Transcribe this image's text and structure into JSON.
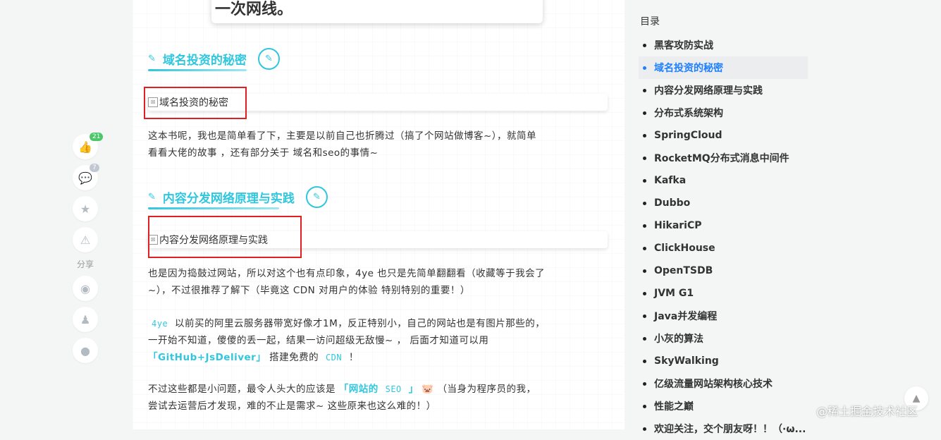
{
  "quote": {
    "text": "一次网线。"
  },
  "sections": [
    {
      "heading": "域名投资的秘密",
      "image_alt": "域名投资的秘密",
      "paragraph_1": "这本书呢，我也是简单看了下，主要是以前自己也折腾过（搞了个网站做博客~），就简单",
      "paragraph_2": "看看大佬的故事 ，还有部分关于 域名和seo的事情~"
    },
    {
      "heading": "内容分发网络原理与实践",
      "image_alt": "内容分发网络原理与实践",
      "p1_line1": "也是因为捣鼓过网站，所以对这个也有点印象，4ye 也只是先简单翻翻看（收藏等于我会了",
      "p1_line2": "~），不过很推荐了解下（毕竟这 CDN 对用户的体验 特别特别的重要！）",
      "p2_code_1": "4ye",
      "p2_line1": "以前买的阿里云服务器带宽好像才1M，反正特别小，自己的网站也是有图片那些的，",
      "p2_line2": "一开始不知道，傻傻的丢一起，结果一访问超级无敌慢~ ，  后面才知道可以用",
      "p2_hl_1": "「GitHub+JsDeliver」",
      "p2_mid": "搭建免费的",
      "p2_code_2": "CDN",
      "p2_end": "！",
      "p3_start": "不过这些都是小问题，最令人头大的应该是",
      "p3_hl_1": "「网站的",
      "p3_code": "SEO",
      "p3_hl_2": "」",
      "p3_emoji": "🐷",
      "p3_end": "（当身为程序员的我，",
      "p3_line2": "尝试去运营后才发现，难的不止是需求~ 这些原来也这么难的！）"
    }
  ],
  "actions": {
    "like_count": "21",
    "comment_count": "7",
    "share_label": "分享"
  },
  "toc": {
    "title": "目录",
    "items": [
      "黑客攻防实战",
      "域名投资的秘密",
      "内容分发网络原理与实践",
      "分布式系统架构",
      "SpringCloud",
      "RocketMQ分布式消息中间件",
      "Kafka",
      "Dubbo",
      "HikariCP",
      "ClickHouse",
      "OpenTSDB",
      "JVM G1",
      "Java并发编程",
      "小灰的算法",
      "SkyWalking",
      "亿级流量网站架构核心技术",
      "性能之巅",
      "欢迎关注，交个朋友呀！！（·ω..."
    ],
    "active_index": 1
  },
  "watermark": "@稀土掘金技术社区",
  "colors": {
    "accent": "#30c7de",
    "toc_active": "#1e80ff",
    "red_box": "#e02020"
  }
}
